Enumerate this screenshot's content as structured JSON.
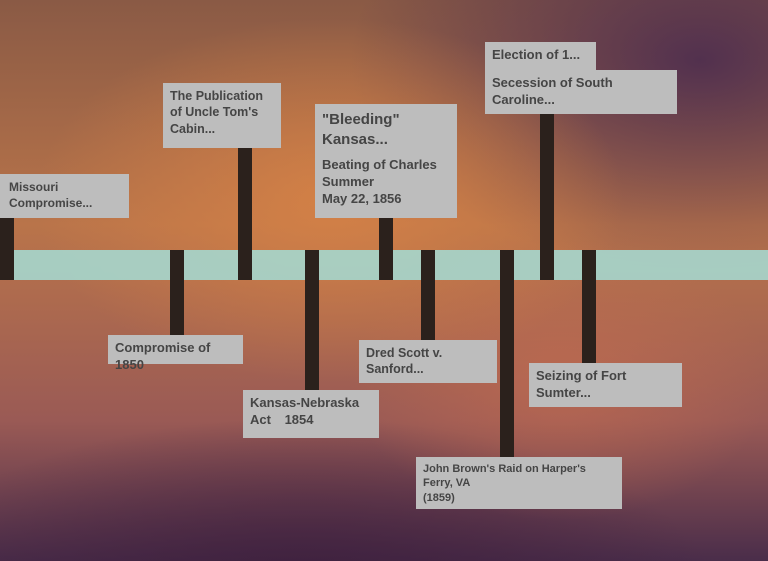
{
  "events": {
    "missouri": "Missouri Compromise...",
    "uncle_tom": "The Publication of Uncle Tom's Cabin...",
    "bleeding_kansas": "\"Bleeding\" Kansas...",
    "beating": "Beating of Charles Summer",
    "beating_date": "May 22, 1856",
    "election": "Election of 1...",
    "secession": "Secession of South Caroline...",
    "compromise_1850": "Compromise of 1850",
    "kansas_nebraska": "Kansas-Nebraska Act",
    "kansas_nebraska_year": "1854",
    "dred_scott": "Dred Scott v. Sanford...",
    "john_brown": "John Brown's Raid on Harper's Ferry, VA",
    "john_brown_year": "(1859)",
    "fort_sumter": "Seizing of Fort Sumter..."
  },
  "colors": {
    "band": "#a6d5cb",
    "stem": "#2b211c",
    "box": "#bdbdbd",
    "text": "#454545"
  }
}
